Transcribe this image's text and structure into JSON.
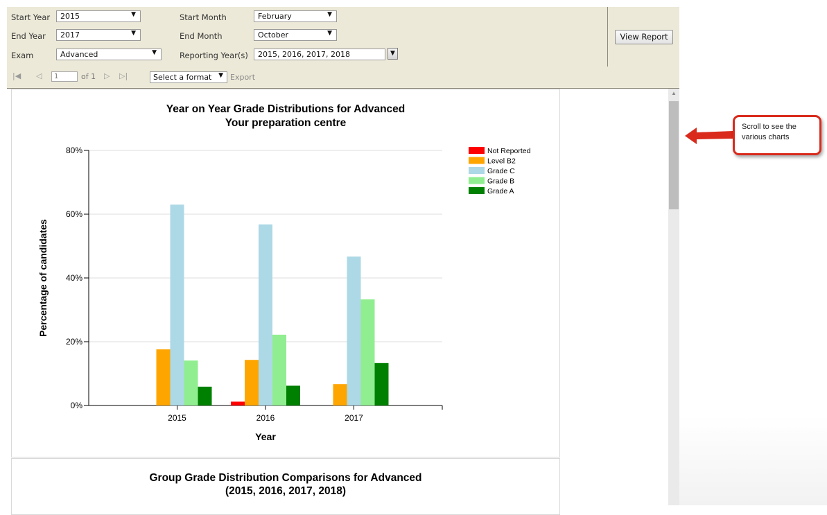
{
  "params": {
    "start_year_label": "Start Year",
    "start_year_value": "2015",
    "end_year_label": "End Year",
    "end_year_value": "2017",
    "exam_label": "Exam",
    "exam_value": "Advanced",
    "start_month_label": "Start Month",
    "start_month_value": "February",
    "end_month_label": "End Month",
    "end_month_value": "October",
    "reporting_years_label": "Reporting Year(s)",
    "reporting_years_value": "2015, 2016, 2017, 2018",
    "view_report_label": "View Report"
  },
  "toolbar": {
    "page_value": "1",
    "of_text": "of 1",
    "format_value": "Select a format",
    "export_label": "Export"
  },
  "chart": {
    "title_line1": "Year on Year Grade Distributions for Advanced",
    "title_line2": "Your preparation centre"
  },
  "chart2": {
    "title_line1": "Group Grade Distribution Comparisons for Advanced",
    "title_line2": "(2015, 2016, 2017, 2018)"
  },
  "callout": {
    "text": "Scroll to see the various charts"
  },
  "chart_data": {
    "type": "bar",
    "title": "Year on Year Grade Distributions for Advanced",
    "subtitle": "Your preparation centre",
    "xlabel": "Year",
    "ylabel": "Percentage of candidates",
    "categories": [
      "2015",
      "2016",
      "2017"
    ],
    "ylim": [
      0,
      80
    ],
    "yticks": [
      0,
      20,
      40,
      60,
      80
    ],
    "ytick_labels": [
      "0%",
      "20%",
      "40%",
      "60%",
      "80%"
    ],
    "grid": true,
    "legend_position": "top-right",
    "series": [
      {
        "name": "Not Reported",
        "color": "#FF0000",
        "values": [
          0,
          1.2,
          0
        ]
      },
      {
        "name": "Level B2",
        "color": "#FFA500",
        "values": [
          17.6,
          14.3,
          6.7
        ]
      },
      {
        "name": "Grade C",
        "color": "#ADD8E6",
        "values": [
          63,
          56.8,
          46.7
        ]
      },
      {
        "name": "Grade B",
        "color": "#90EE90",
        "values": [
          14.1,
          22.2,
          33.3
        ]
      },
      {
        "name": "Grade A",
        "color": "#008000",
        "values": [
          5.9,
          6.2,
          13.3
        ]
      }
    ]
  }
}
